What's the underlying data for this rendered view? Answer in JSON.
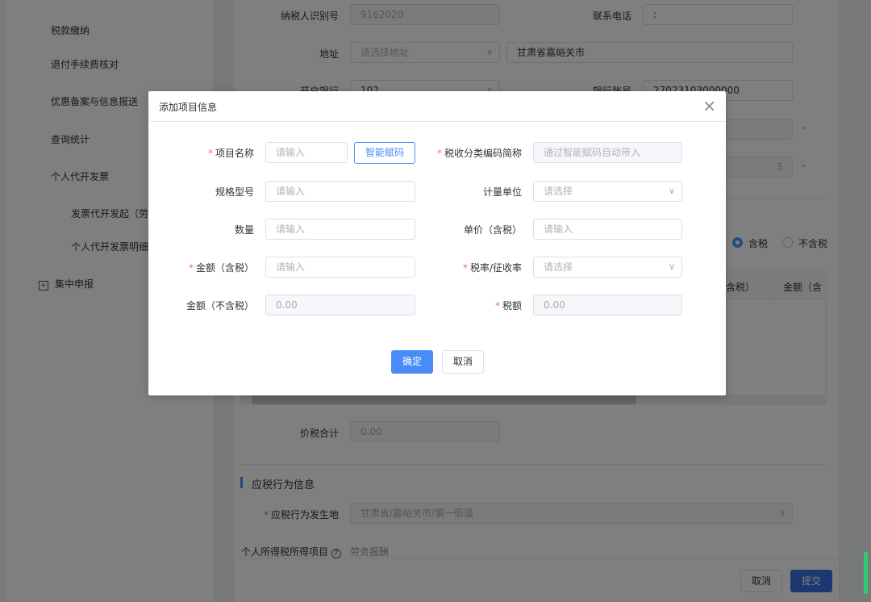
{
  "sidebar": {
    "items": [
      {
        "label": "税款缴纳"
      },
      {
        "label": "退付手续费核对"
      },
      {
        "label": "优惠备案与信息报送"
      },
      {
        "label": "查询统计"
      },
      {
        "label": "个人代开发票"
      },
      {
        "label": "发票代开发起（劳务"
      },
      {
        "label": "个人代开发票明细查"
      },
      {
        "label": "集中申报"
      }
    ]
  },
  "form": {
    "taxpayer_id_label": "纳税人识别号",
    "taxpayer_id_value": "9162020",
    "phone_label": "联系电话",
    "phone_value": ":",
    "address_label": "地址",
    "address_placeholder": "请选择地址",
    "address_detail": "甘肃省嘉峪关市",
    "bank_label": "开户银行",
    "bank_value": "102",
    "account_label": "银行账号",
    "account_value": "27023103000000",
    "partial_value": "3",
    "tax_incl": "含税",
    "tax_excl": "不含税",
    "table_headers": [
      "（含税）",
      "金额（含"
    ],
    "total_label": "价税合计",
    "total_value": "0.00",
    "section_title": "应税行为信息",
    "location_label": "应税行为发生地",
    "location_value": "甘肃省/嘉峪关市/第一街道",
    "income_label": "个人所得税所得项目",
    "income_value": "劳务报酬",
    "cancel": "取消",
    "submit": "提交"
  },
  "dialog": {
    "title": "添加项目信息",
    "close": "×",
    "item_name_label": "项目名称",
    "item_name_ph": "请输入",
    "smart_code": "智能赋码",
    "tax_code_label": "税收分类编码简称",
    "tax_code_ph": "通过智能赋码自动带入",
    "spec_label": "规格型号",
    "spec_ph": "请输入",
    "unit_label": "计量单位",
    "unit_ph": "请选择",
    "qty_label": "数量",
    "qty_ph": "请输入",
    "price_label": "单价（含税）",
    "price_ph": "请输入",
    "amount_incl_label": "金额（含税）",
    "amount_incl_ph": "请输入",
    "rate_label": "税率/征收率",
    "rate_ph": "请选择",
    "amount_excl_label": "金额（不含税）",
    "amount_excl_value": "0.00",
    "tax_label": "税额",
    "tax_value": "0.00",
    "confirm": "确定",
    "cancel": "取消"
  },
  "colors": {
    "primary": "#4a8cf7",
    "required": "#f56c6c"
  }
}
